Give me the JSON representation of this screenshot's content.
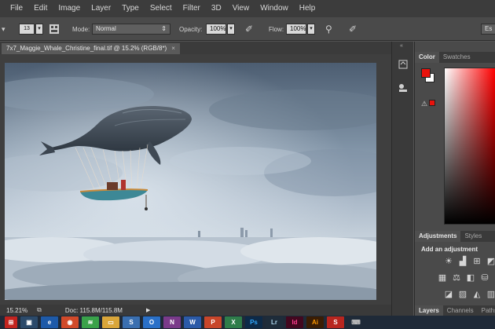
{
  "menu": [
    "File",
    "Edit",
    "Image",
    "Layer",
    "Type",
    "Select",
    "Filter",
    "3D",
    "View",
    "Window",
    "Help"
  ],
  "options": {
    "brush_size": "13",
    "mode_label": "Mode:",
    "mode_value": "Normal",
    "opacity_label": "Opacity:",
    "opacity_value": "100%",
    "flow_label": "Flow:",
    "flow_value": "100%",
    "right_button": "Es"
  },
  "document": {
    "tab_title": "7x7_Maggie_Whale_Christine_final.tif @ 15.2% (RGB/8*)",
    "tab_close": "×"
  },
  "status": {
    "zoom": "15.21%",
    "doc": "Doc: 115.8M/115.8M",
    "arrow": "▶"
  },
  "panels": {
    "color_tabs": [
      "Color",
      "Swatches"
    ],
    "foreground_color": "#e8120c",
    "background_color": "#ffffff",
    "warning_color": "#e8120c",
    "adjust_tabs": [
      "Adjustments",
      "Styles"
    ],
    "adjust_title": "Add an adjustment",
    "layer_tabs": [
      "Layers",
      "Channels",
      "Paths"
    ]
  },
  "icons": {
    "brush_preset": "brush-preset-icon",
    "brush_panel": "brush-panel-icon",
    "airbrush": "airbrush-icon",
    "pressure": "pressure-icon",
    "history": "history-icon",
    "properties": "properties-icon",
    "gamut_warning": "gamut-warning-icon"
  },
  "taskbar": {
    "apps": [
      "Ps",
      "Lr",
      "Id",
      "Ai"
    ],
    "app_colors": [
      "#0d2a48",
      "#1e2c3a",
      "#42081f",
      "#3a1d04"
    ]
  }
}
